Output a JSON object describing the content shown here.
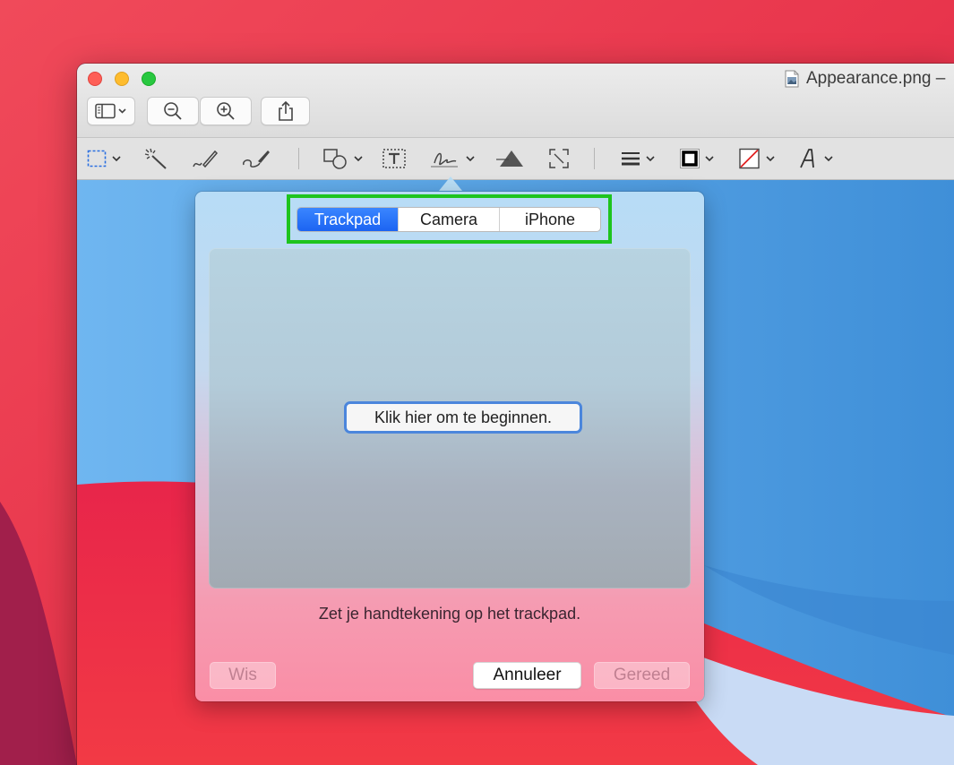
{
  "window": {
    "title": "Appearance.png –"
  },
  "toolbar": {
    "icons": [
      "sidebar-icon",
      "zoom-out-icon",
      "zoom-in-icon",
      "share-icon"
    ]
  },
  "markup_toolbar": {
    "icons": [
      "rectangular-selection-icon",
      "instant-alpha-icon",
      "sketch-icon",
      "draw-icon",
      "shapes-icon",
      "text-box-icon",
      "signature-icon",
      "adjust-color-icon",
      "adjust-size-icon",
      "shape-style-icon",
      "border-color-icon",
      "fill-color-icon",
      "text-style-icon"
    ]
  },
  "signature_popover": {
    "tabs": [
      {
        "label": "Trackpad",
        "active": true
      },
      {
        "label": "Camera",
        "active": false
      },
      {
        "label": "iPhone",
        "active": false
      }
    ],
    "start_button": "Klik hier om te beginnen.",
    "hint": "Zet je handtekening op het trackpad.",
    "clear_button": "Wis",
    "cancel_button": "Annuleer",
    "done_button": "Gereed"
  },
  "colors": {
    "highlight_box": "#1ec41e",
    "active_tab": "#1c64f2",
    "focus_ring": "#4b86dc"
  }
}
